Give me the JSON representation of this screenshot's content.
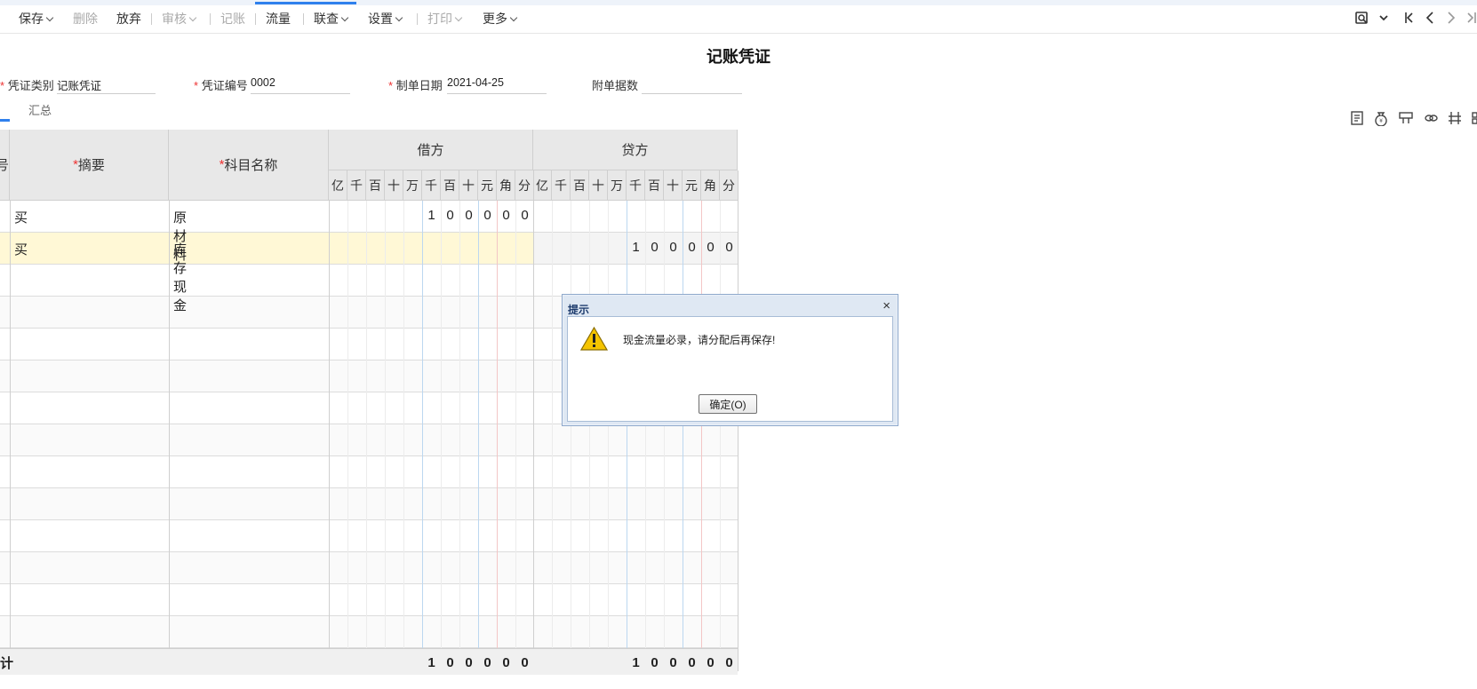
{
  "toolbar": {
    "save": "保存",
    "delete": "删除",
    "abandon": "放弃",
    "audit": "审核",
    "post": "记账",
    "cashflow": "流量",
    "link": "联查",
    "settings": "设置",
    "print": "打印",
    "more": "更多"
  },
  "voucher": {
    "title": "记账凭证",
    "type_label": "凭证类别",
    "type_value": "记账凭证",
    "number_label": "凭证编号",
    "number_value": "0002",
    "date_label": "制单日期",
    "date_value": "2021-04-25",
    "attachments_label": "附单据数",
    "attachments_value": "",
    "summary_tab": "汇总"
  },
  "table": {
    "col_seq_partial": "号",
    "col_summary": "摘要",
    "col_account": "科目名称",
    "col_debit": "借方",
    "col_credit": "贷方",
    "units": [
      "亿",
      "千",
      "百",
      "十",
      "万",
      "千",
      "百",
      "十",
      "元",
      "角",
      "分"
    ],
    "rows": [
      {
        "summary": "买",
        "account": "原材料",
        "debit": [
          "",
          "",
          "",
          "",
          "",
          "1",
          "0",
          "0",
          "0",
          "0",
          "0"
        ],
        "credit": [
          "",
          "",
          "",
          "",
          "",
          "",
          "",
          "",
          "",
          "",
          ""
        ]
      },
      {
        "summary": "买",
        "account": "库存现金",
        "debit": [
          "",
          "",
          "",
          "",
          "",
          "",
          "",
          "",
          "",
          "",
          ""
        ],
        "credit": [
          "",
          "",
          "",
          "",
          "",
          "1",
          "0",
          "0",
          "0",
          "0",
          "0"
        ]
      }
    ],
    "total_partial": "计",
    "total_debit": [
      "",
      "",
      "",
      "",
      "",
      "1",
      "0",
      "0",
      "0",
      "0",
      "0"
    ],
    "total_credit": [
      "",
      "",
      "",
      "",
      "",
      "1",
      "0",
      "0",
      "0",
      "0",
      "0"
    ]
  },
  "dialog": {
    "title": "提示",
    "close": "×",
    "message": "现金流量必录，请分配后再保存!",
    "ok": "确定(O)"
  }
}
